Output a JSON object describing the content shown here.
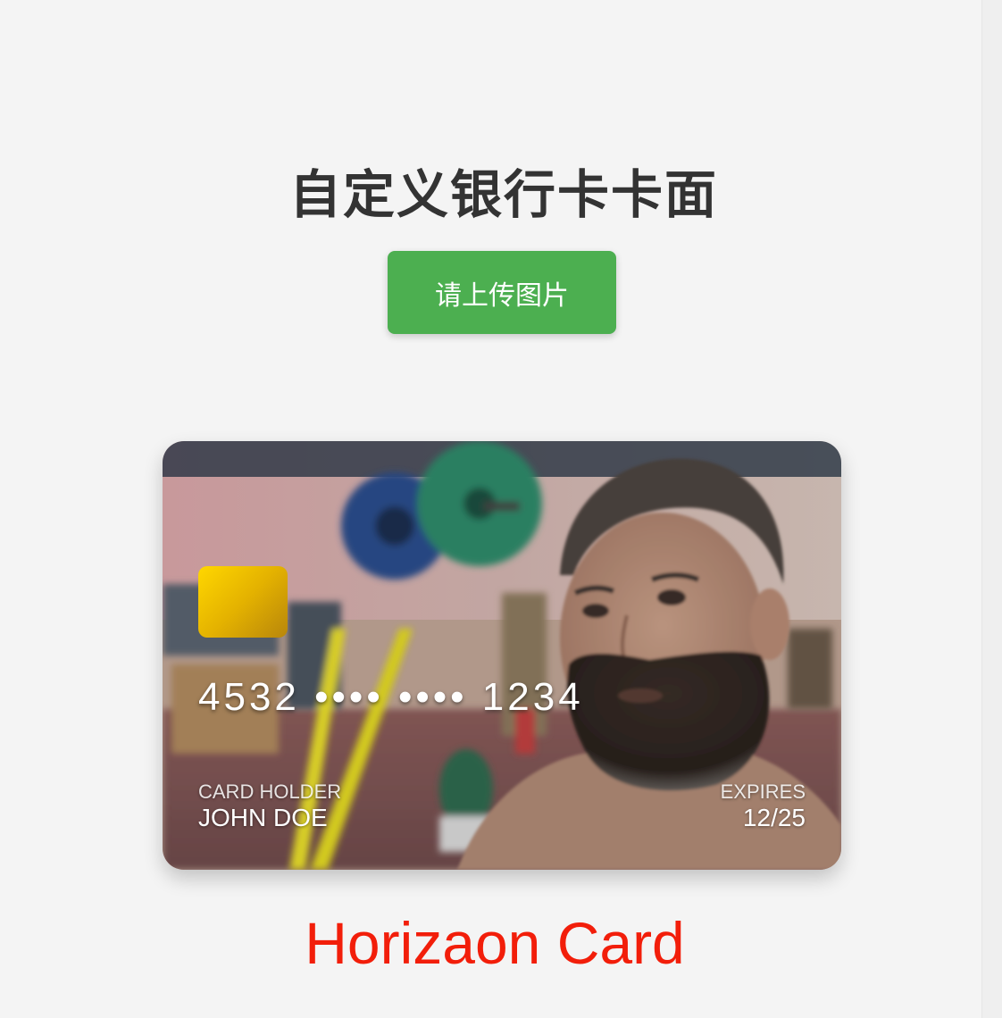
{
  "page": {
    "title": "自定义银行卡卡面",
    "upload_button_label": "请上传图片",
    "brand_text": "Horizaon Card"
  },
  "card": {
    "number": "4532 •••• •••• 1234",
    "holder_label": "CARD HOLDER",
    "holder_name": "JOHN DOE",
    "expires_label": "EXPIRES",
    "expires_value": "12/25",
    "background_image": "user-uploaded-photo"
  },
  "colors": {
    "background": "#f4f4f4",
    "title": "#333333",
    "upload_button": "#4caf50",
    "brand_text": "#f21e0a",
    "chip": "#ffd700"
  }
}
